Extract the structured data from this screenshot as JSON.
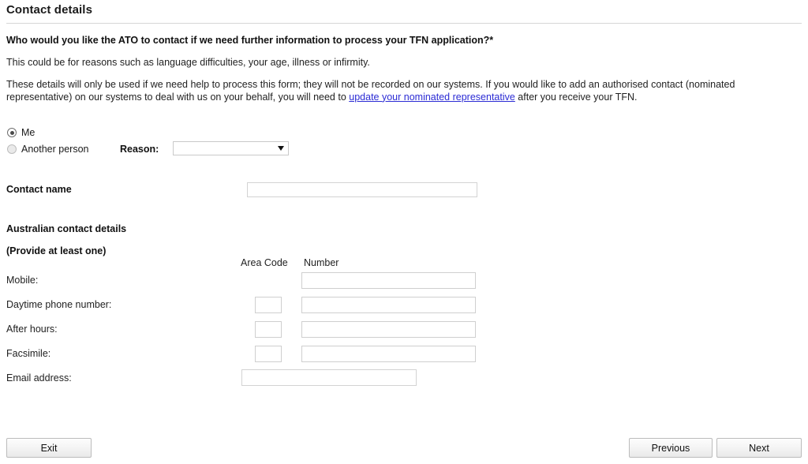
{
  "header": {
    "title": "Contact details"
  },
  "intro": {
    "question": "Who would you like the ATO to contact if we need further information to process your TFN application?*",
    "sub_note": "This could be for reasons such as language difficulties, your age, illness or infirmity.",
    "privacy_part1": "These details will only be used if we need help to process this form; they will not be recorded on our systems. If you would like to add an authorised contact (nominated representative) on our systems to deal with us on your behalf, you will need to ",
    "privacy_link": "update your nominated representative",
    "privacy_part2": " after you receive your TFN."
  },
  "contact_choice": {
    "option_me": "Me",
    "option_another": "Another person",
    "selected": "Me",
    "reason_label": "Reason:",
    "reason_value": "",
    "reason_placeholder": ""
  },
  "contact_name": {
    "label": "Contact name",
    "value": "",
    "placeholder": ""
  },
  "australian_contact": {
    "heading": "Australian contact details",
    "subheading": "(Provide at least one)",
    "columns": {
      "area_code": "Area Code",
      "number": "Number"
    },
    "rows": [
      {
        "label": "Mobile:",
        "area_code": "",
        "number": "",
        "has_area_code": false
      },
      {
        "label": "Daytime phone number:",
        "area_code": "",
        "number": "",
        "has_area_code": true
      },
      {
        "label": "After hours:",
        "area_code": "",
        "number": "",
        "has_area_code": true
      },
      {
        "label": "Facsimile:",
        "area_code": "",
        "number": "",
        "has_area_code": true
      }
    ],
    "email": {
      "label": "Email address:",
      "value": "",
      "placeholder": ""
    }
  },
  "footer": {
    "exit_label": "Exit",
    "previous_label": "Previous",
    "next_label": "Next"
  },
  "colors": {
    "link": "#2b2bd4",
    "text": "#1a1a1a",
    "rule": "#d6d6d6",
    "input_border": "#cfcfcf",
    "button_border": "#bcbcbc"
  }
}
